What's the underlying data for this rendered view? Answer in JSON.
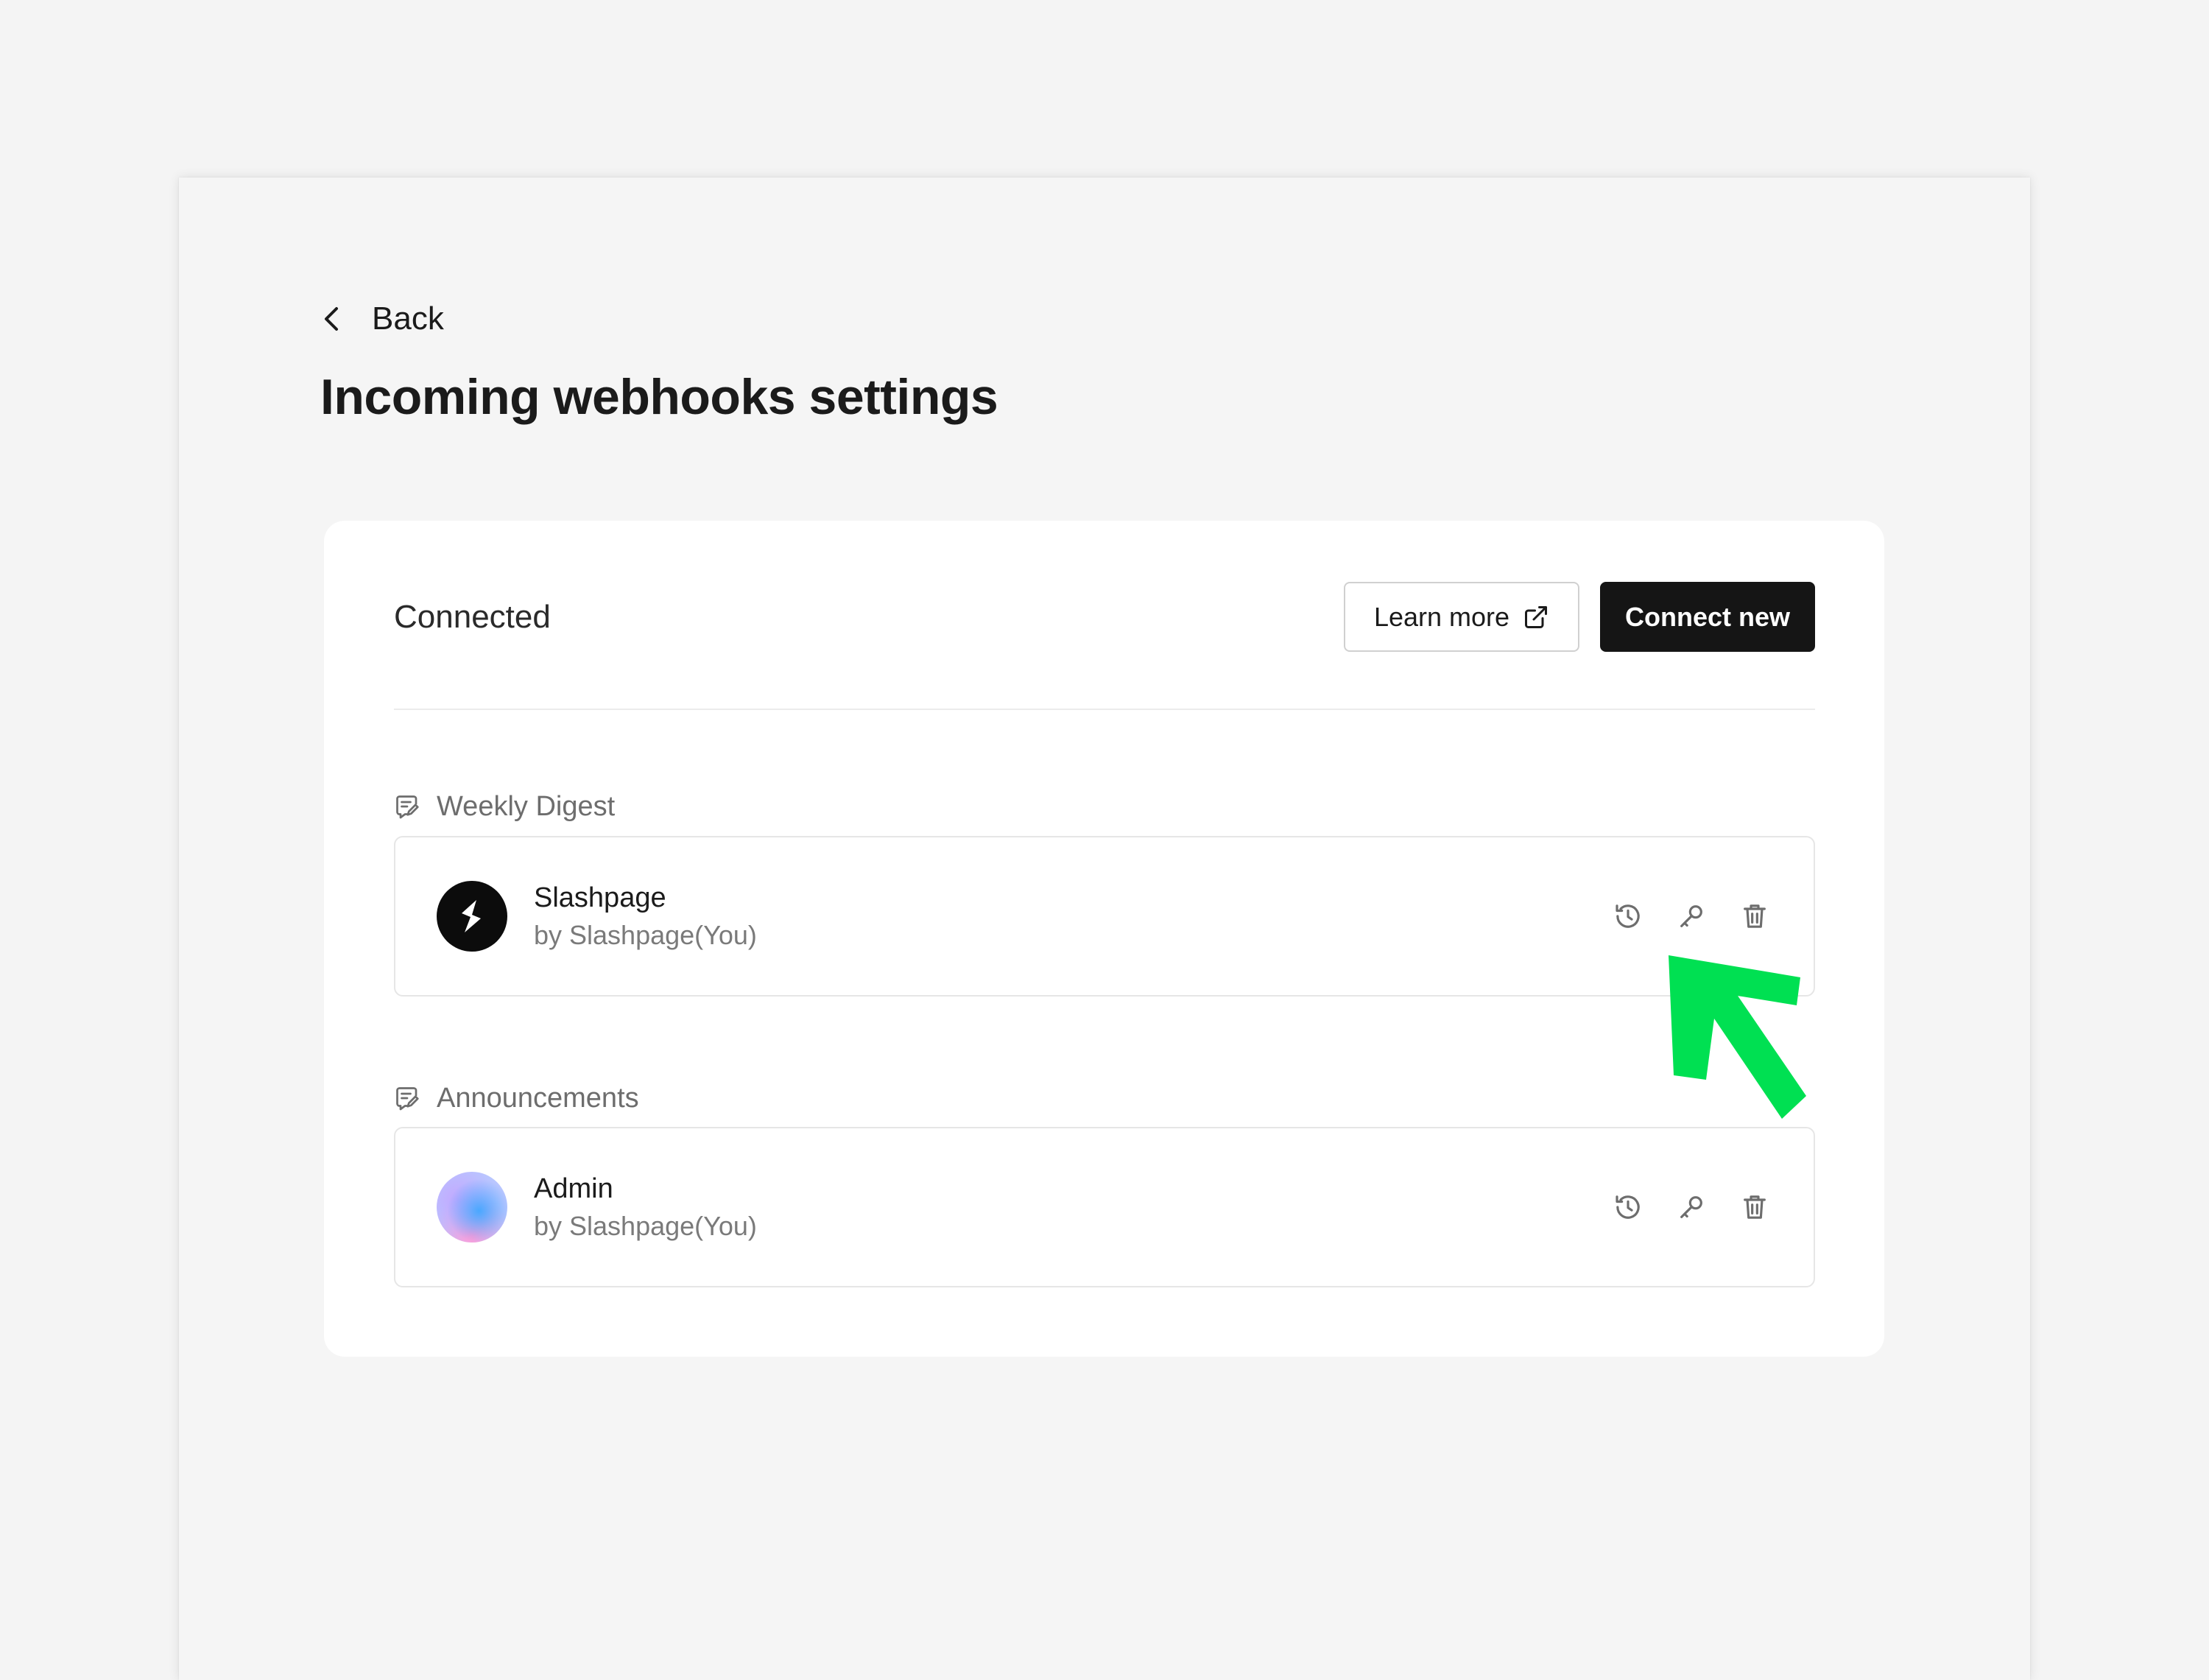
{
  "back": {
    "label": "Back"
  },
  "page": {
    "title": "Incoming webhooks settings"
  },
  "card": {
    "heading": "Connected",
    "learn_more_label": "Learn more",
    "connect_new_label": "Connect new"
  },
  "groups": [
    {
      "label": "Weekly Digest",
      "item": {
        "name": "Slashpage",
        "owner": "by Slashpage(You)",
        "avatar": "slashpage-logo"
      }
    },
    {
      "label": "Announcements",
      "item": {
        "name": "Admin",
        "owner": "by Slashpage(You)",
        "avatar": "gradient-orb"
      }
    }
  ],
  "icons": {
    "back": "chevron-left-icon",
    "external": "external-link-icon",
    "group": "edit-note-icon",
    "history": "history-icon",
    "key": "key-icon",
    "delete": "trash-icon"
  },
  "colors": {
    "primary_button": "#151515",
    "annotation_arrow": "#00e052",
    "page_background": "#f4f4f4",
    "card_background": "#ffffff"
  }
}
